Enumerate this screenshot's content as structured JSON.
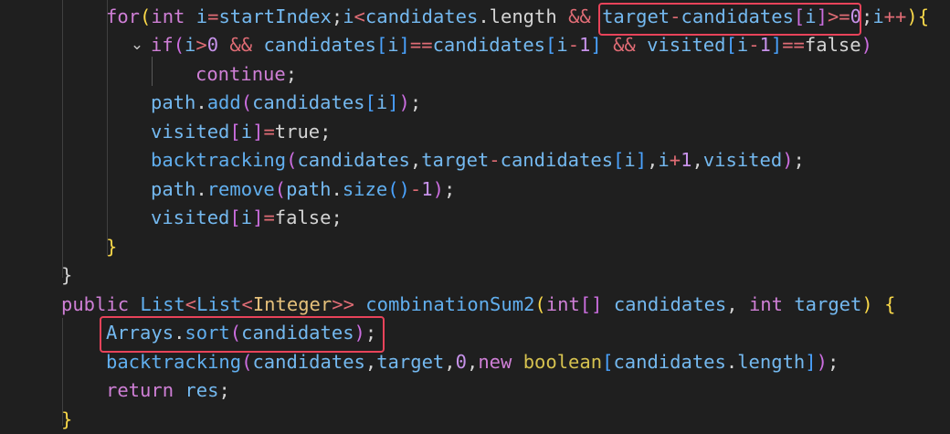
{
  "editor": {
    "language": "java",
    "theme_colors": {
      "background": "#1f1f1f",
      "keyword": "#cf7fd6",
      "function": "#61afef",
      "variable": "#74b9f0",
      "operator": "#e06c75",
      "number": "#c792ea",
      "type": "#e5c07b",
      "highlight_box": "#e8435a"
    },
    "lines": [
      {
        "tokens": [
          [
            "kw",
            "for"
          ],
          [
            "b1",
            "("
          ],
          [
            "kw",
            "int "
          ],
          [
            "var",
            "i"
          ],
          [
            "op",
            "="
          ],
          [
            "var",
            "startIndex"
          ],
          [
            "pl",
            ";"
          ],
          [
            "var",
            "i"
          ],
          [
            "op",
            "<"
          ],
          [
            "var",
            "candidates"
          ],
          [
            "pl",
            ".length "
          ],
          [
            "op",
            "&& "
          ],
          [
            "var",
            "target"
          ],
          [
            "op",
            "-"
          ],
          [
            "var",
            "candidates"
          ],
          [
            "b2",
            "["
          ],
          [
            "var",
            "i"
          ],
          [
            "b2",
            "]"
          ],
          [
            "op",
            ">="
          ],
          [
            "num",
            "0"
          ],
          [
            "pl",
            ";"
          ],
          [
            "var",
            "i"
          ],
          [
            "op",
            "++"
          ],
          [
            "b1",
            ")"
          ],
          [
            "b1",
            "{"
          ]
        ]
      },
      {
        "tokens": [
          [
            "kw",
            "if"
          ],
          [
            "b2",
            "("
          ],
          [
            "var",
            "i"
          ],
          [
            "op",
            ">"
          ],
          [
            "num",
            "0 "
          ],
          [
            "op",
            "&& "
          ],
          [
            "var",
            "candidates"
          ],
          [
            "b3",
            "["
          ],
          [
            "var",
            "i"
          ],
          [
            "b3",
            "]"
          ],
          [
            "op",
            "=="
          ],
          [
            "var",
            "candidates"
          ],
          [
            "b3",
            "["
          ],
          [
            "var",
            "i"
          ],
          [
            "op",
            "-"
          ],
          [
            "num",
            "1"
          ],
          [
            "b3",
            "] "
          ],
          [
            "op",
            "&& "
          ],
          [
            "var",
            "visited"
          ],
          [
            "b3",
            "["
          ],
          [
            "var",
            "i"
          ],
          [
            "op",
            "-"
          ],
          [
            "num",
            "1"
          ],
          [
            "b3",
            "]"
          ],
          [
            "op",
            "=="
          ],
          [
            "pl",
            "false"
          ],
          [
            "b2",
            ")"
          ]
        ]
      },
      {
        "tokens": [
          [
            "kw",
            "continue"
          ],
          [
            "pl",
            ";"
          ]
        ]
      },
      {
        "tokens": [
          [
            "var",
            "path"
          ],
          [
            "pl",
            "."
          ],
          [
            "fn",
            "add"
          ],
          [
            "b2",
            "("
          ],
          [
            "var",
            "candidates"
          ],
          [
            "b3",
            "["
          ],
          [
            "var",
            "i"
          ],
          [
            "b3",
            "]"
          ],
          [
            "b2",
            ")"
          ],
          [
            "pl",
            ";"
          ]
        ]
      },
      {
        "tokens": [
          [
            "var",
            "visited"
          ],
          [
            "b2",
            "["
          ],
          [
            "var",
            "i"
          ],
          [
            "b2",
            "]"
          ],
          [
            "op",
            "="
          ],
          [
            "pl",
            "true;"
          ]
        ]
      },
      {
        "tokens": [
          [
            "fn",
            "backtracking"
          ],
          [
            "b2",
            "("
          ],
          [
            "var",
            "candidates"
          ],
          [
            "pl",
            ","
          ],
          [
            "var",
            "target"
          ],
          [
            "op",
            "-"
          ],
          [
            "var",
            "candidates"
          ],
          [
            "b3",
            "["
          ],
          [
            "var",
            "i"
          ],
          [
            "b3",
            "]"
          ],
          [
            "pl",
            ","
          ],
          [
            "var",
            "i"
          ],
          [
            "op",
            "+"
          ],
          [
            "num",
            "1"
          ],
          [
            "pl",
            ","
          ],
          [
            "var",
            "visited"
          ],
          [
            "b2",
            ")"
          ],
          [
            "pl",
            ";"
          ]
        ]
      },
      {
        "tokens": [
          [
            "var",
            "path"
          ],
          [
            "pl",
            "."
          ],
          [
            "fn",
            "remove"
          ],
          [
            "b2",
            "("
          ],
          [
            "var",
            "path"
          ],
          [
            "pl",
            "."
          ],
          [
            "fn",
            "size"
          ],
          [
            "b3",
            "()"
          ],
          [
            "op",
            "-"
          ],
          [
            "num",
            "1"
          ],
          [
            "b2",
            ")"
          ],
          [
            "pl",
            ";"
          ]
        ]
      },
      {
        "tokens": [
          [
            "var",
            "visited"
          ],
          [
            "b2",
            "["
          ],
          [
            "var",
            "i"
          ],
          [
            "b2",
            "]"
          ],
          [
            "op",
            "="
          ],
          [
            "pl",
            "false;"
          ]
        ]
      },
      {
        "tokens": [
          [
            "b1",
            "}"
          ]
        ]
      },
      {
        "tokens": [
          [
            "pl",
            "}"
          ]
        ]
      },
      {
        "tokens": [
          [
            "kw",
            "public "
          ],
          [
            "fn",
            "List"
          ],
          [
            "op",
            "<"
          ],
          [
            "fn",
            "List"
          ],
          [
            "op",
            "<"
          ],
          [
            "ty",
            "Integer"
          ],
          [
            "op",
            ">> "
          ],
          [
            "fn",
            "combinationSum2"
          ],
          [
            "b1",
            "("
          ],
          [
            "kw",
            "int"
          ],
          [
            "b2",
            "[]"
          ],
          [
            "var",
            " candidates"
          ],
          [
            "pl",
            ", "
          ],
          [
            "kw",
            "int "
          ],
          [
            "var",
            "target"
          ],
          [
            "b1",
            ")"
          ],
          [
            "pl",
            " "
          ],
          [
            "b1",
            "{"
          ]
        ]
      },
      {
        "tokens": [
          [
            "var",
            "Arrays"
          ],
          [
            "pl",
            "."
          ],
          [
            "fn",
            "sort"
          ],
          [
            "b2",
            "("
          ],
          [
            "var",
            "candidates"
          ],
          [
            "b2",
            ")"
          ],
          [
            "pl",
            ";"
          ]
        ]
      },
      {
        "tokens": [
          [
            "fn",
            "backtracking"
          ],
          [
            "b2",
            "("
          ],
          [
            "var",
            "candidates"
          ],
          [
            "pl",
            ","
          ],
          [
            "var",
            "target"
          ],
          [
            "pl",
            ","
          ],
          [
            "num",
            "0"
          ],
          [
            "pl",
            ","
          ],
          [
            "kw",
            "new "
          ],
          [
            "kw2",
            "boolean"
          ],
          [
            "b3",
            "["
          ],
          [
            "var",
            "candidates"
          ],
          [
            "pl",
            "."
          ],
          [
            "var",
            "length"
          ],
          [
            "b3",
            "]"
          ],
          [
            "b2",
            ")"
          ],
          [
            "pl",
            ";"
          ]
        ]
      },
      {
        "tokens": [
          [
            "kw",
            "return "
          ],
          [
            "var",
            "res"
          ],
          [
            "pl",
            ";"
          ]
        ]
      },
      {
        "tokens": [
          [
            "b1",
            "}"
          ]
        ]
      }
    ]
  }
}
